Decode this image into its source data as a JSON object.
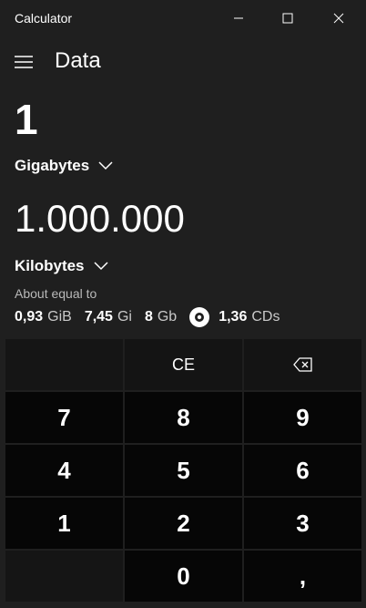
{
  "window": {
    "title": "Calculator",
    "controls": {
      "minimize_icon": "minimize-icon",
      "maximize_icon": "maximize-icon",
      "close_icon": "close-icon"
    }
  },
  "header": {
    "menu_icon": "hamburger-icon",
    "mode": "Data"
  },
  "converter": {
    "from": {
      "value": "1",
      "unit": "Gigabytes"
    },
    "to": {
      "value": "1.000.000",
      "unit": "Kilobytes"
    },
    "about_label": "About equal to",
    "equivalents": [
      {
        "value": "0,93",
        "unit": "GiB"
      },
      {
        "value": "7,45",
        "unit": "Gi"
      },
      {
        "value": "8",
        "unit": "Gb"
      },
      {
        "icon": "cd-icon",
        "value": "1,36",
        "unit": "CDs"
      }
    ]
  },
  "keypad": {
    "ce": "CE",
    "backspace_icon": "backspace-icon",
    "keys": [
      "7",
      "8",
      "9",
      "4",
      "5",
      "6",
      "1",
      "2",
      "3",
      "0",
      ","
    ]
  },
  "colors": {
    "background": "#1f1f1f",
    "key": "#060606",
    "key_top": "#141414",
    "text": "#ffffff",
    "muted": "#b9b9b9"
  }
}
